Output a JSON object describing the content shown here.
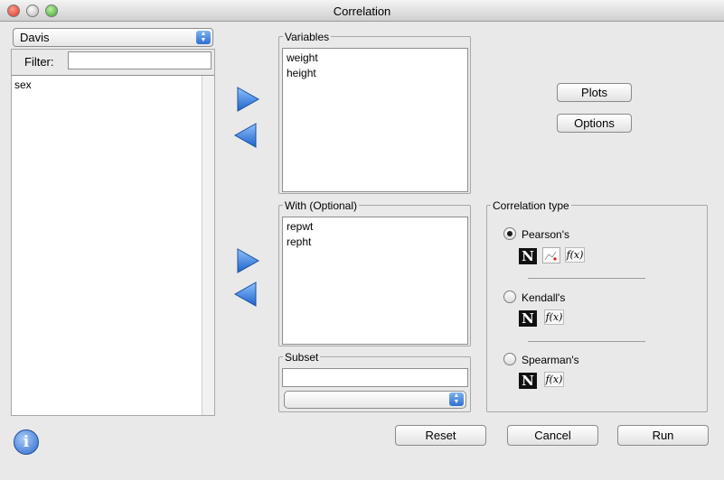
{
  "window": {
    "title": "Correlation"
  },
  "dataset": {
    "selected": "Davis"
  },
  "filter": {
    "label": "Filter:",
    "value": ""
  },
  "available_vars": {
    "items": [
      "sex"
    ]
  },
  "variables": {
    "label": "Variables",
    "items": [
      "weight",
      "height"
    ]
  },
  "with": {
    "label": "With (Optional)",
    "items": [
      "repwt",
      "repht"
    ]
  },
  "subset": {
    "label": "Subset",
    "value": ""
  },
  "buttons": {
    "plots": "Plots",
    "options": "Options",
    "reset": "Reset",
    "cancel": "Cancel",
    "run": "Run"
  },
  "corr_type": {
    "label": "Correlation type",
    "options": [
      {
        "label": "Pearson's",
        "selected": true
      },
      {
        "label": "Kendall's",
        "selected": false
      },
      {
        "label": "Spearman's",
        "selected": false
      }
    ],
    "fx_text": "f(x)",
    "n_text": "N"
  },
  "colors": {
    "arrow": "#2f7fd8",
    "accent": "#2e6fd3"
  }
}
